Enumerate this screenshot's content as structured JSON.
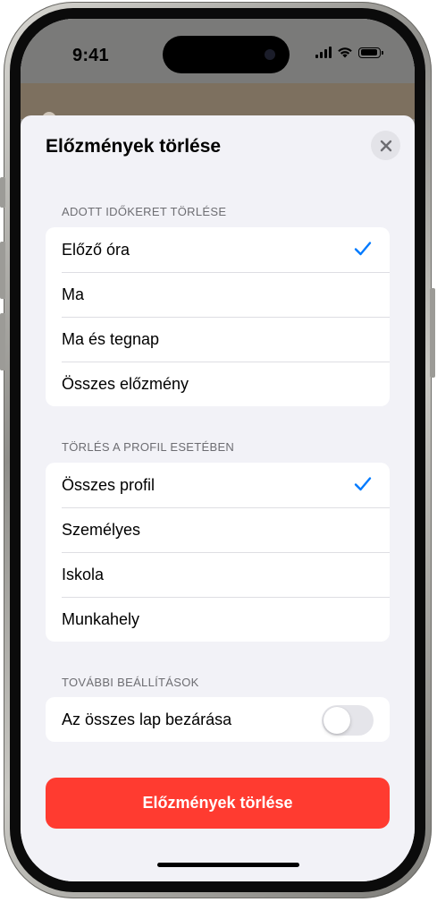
{
  "status_bar": {
    "time": "9:41"
  },
  "sheet": {
    "title": "Előzmények törlése"
  },
  "time_range": {
    "header": "ADOTT IDŐKERET TÖRLÉSE",
    "options": [
      {
        "label": "Előző óra",
        "selected": true
      },
      {
        "label": "Ma",
        "selected": false
      },
      {
        "label": "Ma és tegnap",
        "selected": false
      },
      {
        "label": "Összes előzmény",
        "selected": false
      }
    ]
  },
  "profile": {
    "header": "TÖRLÉS A PROFIL ESETÉBEN",
    "options": [
      {
        "label": "Összes profil",
        "selected": true
      },
      {
        "label": "Személyes",
        "selected": false
      },
      {
        "label": "Iskola",
        "selected": false
      },
      {
        "label": "Munkahely",
        "selected": false
      }
    ]
  },
  "additional": {
    "header": "TOVÁBBI BEÁLLÍTÁSOK",
    "close_all_tabs_label": "Az összes lap bezárása",
    "close_all_tabs_on": false
  },
  "clear_button": {
    "label": "Előzmények törlése"
  },
  "colors": {
    "accent": "#007aff",
    "destructive": "#ff3b30",
    "background": "#f2f2f7"
  }
}
